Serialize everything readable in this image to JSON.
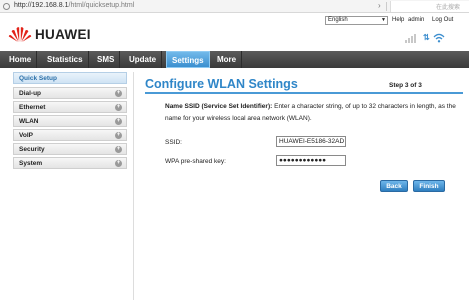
{
  "browser": {
    "url_host": "http://192.168.8.1",
    "url_path": "/html/quicksetup.html",
    "forward_icon": "chevron-right-icon",
    "search_placeholder": "在此搜索"
  },
  "header": {
    "brand": "HUAWEI",
    "language_selected": "English",
    "help_label": "Help",
    "user_label": "admin",
    "logout_label": "Log Out",
    "icons": [
      "signal-icon",
      "transfer-icon",
      "wifi-icon"
    ]
  },
  "nav": {
    "items": [
      {
        "label": "Home"
      },
      {
        "label": "Statistics"
      },
      {
        "label": "SMS"
      },
      {
        "label": "Update"
      },
      {
        "label": "Settings"
      },
      {
        "label": "More"
      }
    ],
    "active_index": 4
  },
  "sidebar": {
    "header": "Quick Setup",
    "items": [
      {
        "label": "Dial-up"
      },
      {
        "label": "Ethernet"
      },
      {
        "label": "WLAN"
      },
      {
        "label": "VoIP"
      },
      {
        "label": "Security"
      },
      {
        "label": "System"
      }
    ]
  },
  "content": {
    "title": "Configure WLAN Settings",
    "step": "Step 3 of 3",
    "desc_bold": "Name SSID (Service Set Identifier):",
    "desc_rest": " Enter a character string, of up to 32 characters in length, as the name for your wireless local area network (WLAN).",
    "ssid_label": "SSID:",
    "ssid_value": "HUAWEI-E5186-32AD",
    "wpa_label": "WPA pre-shared key:",
    "wpa_value": "●●●●●●●●●●●●",
    "back_label": "Back",
    "finish_label": "Finish"
  },
  "colors": {
    "accent": "#2f86c8",
    "nav_bg": "#4a4a4a",
    "logo_red": "#e2231a"
  }
}
